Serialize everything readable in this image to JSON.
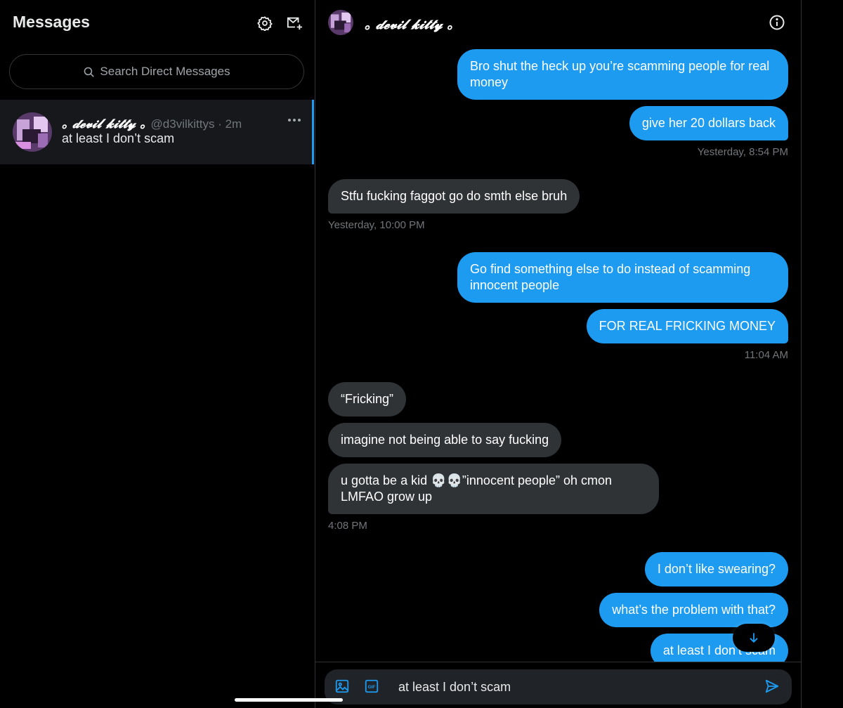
{
  "sidebar": {
    "title": "Messages",
    "search_placeholder": "Search Direct Messages",
    "conversation": {
      "name": "｡ 𝓭𝓮𝓿𝓲𝓵 𝓴𝓲𝓽𝓽𝔂 ｡",
      "handle": "@d3vilkittys · 2m",
      "preview": "at least I don’t scam"
    }
  },
  "chat": {
    "name": "｡ 𝓭𝓮𝓿𝓲𝓵 𝓴𝓲𝓽𝓽𝔂 ｡",
    "messages": [
      {
        "dir": "sent",
        "text": "Bro shut the heck up you’re scamming people for real money"
      },
      {
        "dir": "sent",
        "text": "give her 20 dollars back"
      },
      {
        "dir": "recv",
        "text": "Stfu fucking faggot go do smth else bruh"
      },
      {
        "dir": "sent",
        "text": "Go find something else to do instead of scamming innocent people"
      },
      {
        "dir": "sent",
        "text": "FOR REAL FRICKING MONEY"
      },
      {
        "dir": "recv",
        "text": "“Fricking”"
      },
      {
        "dir": "recv",
        "text": "imagine not being able to say fucking"
      },
      {
        "dir": "recv",
        "text": "u gotta be a kid 💀💀”innocent people” oh cmon LMFAO grow up"
      },
      {
        "dir": "sent",
        "text": "I don’t like swearing?"
      },
      {
        "dir": "sent",
        "text": "what’s the problem with that?"
      },
      {
        "dir": "sent",
        "text": "at least I don’t scam"
      }
    ],
    "timestamps": [
      "Yesterday, 8:54 PM",
      "Yesterday, 10:00 PM",
      "11:04 AM",
      "4:08 PM"
    ]
  },
  "composer": {
    "value": "at least I don’t scam"
  },
  "colors": {
    "accent": "#1d9bf0",
    "received_bubble": "#2f3336",
    "background": "#000000"
  }
}
